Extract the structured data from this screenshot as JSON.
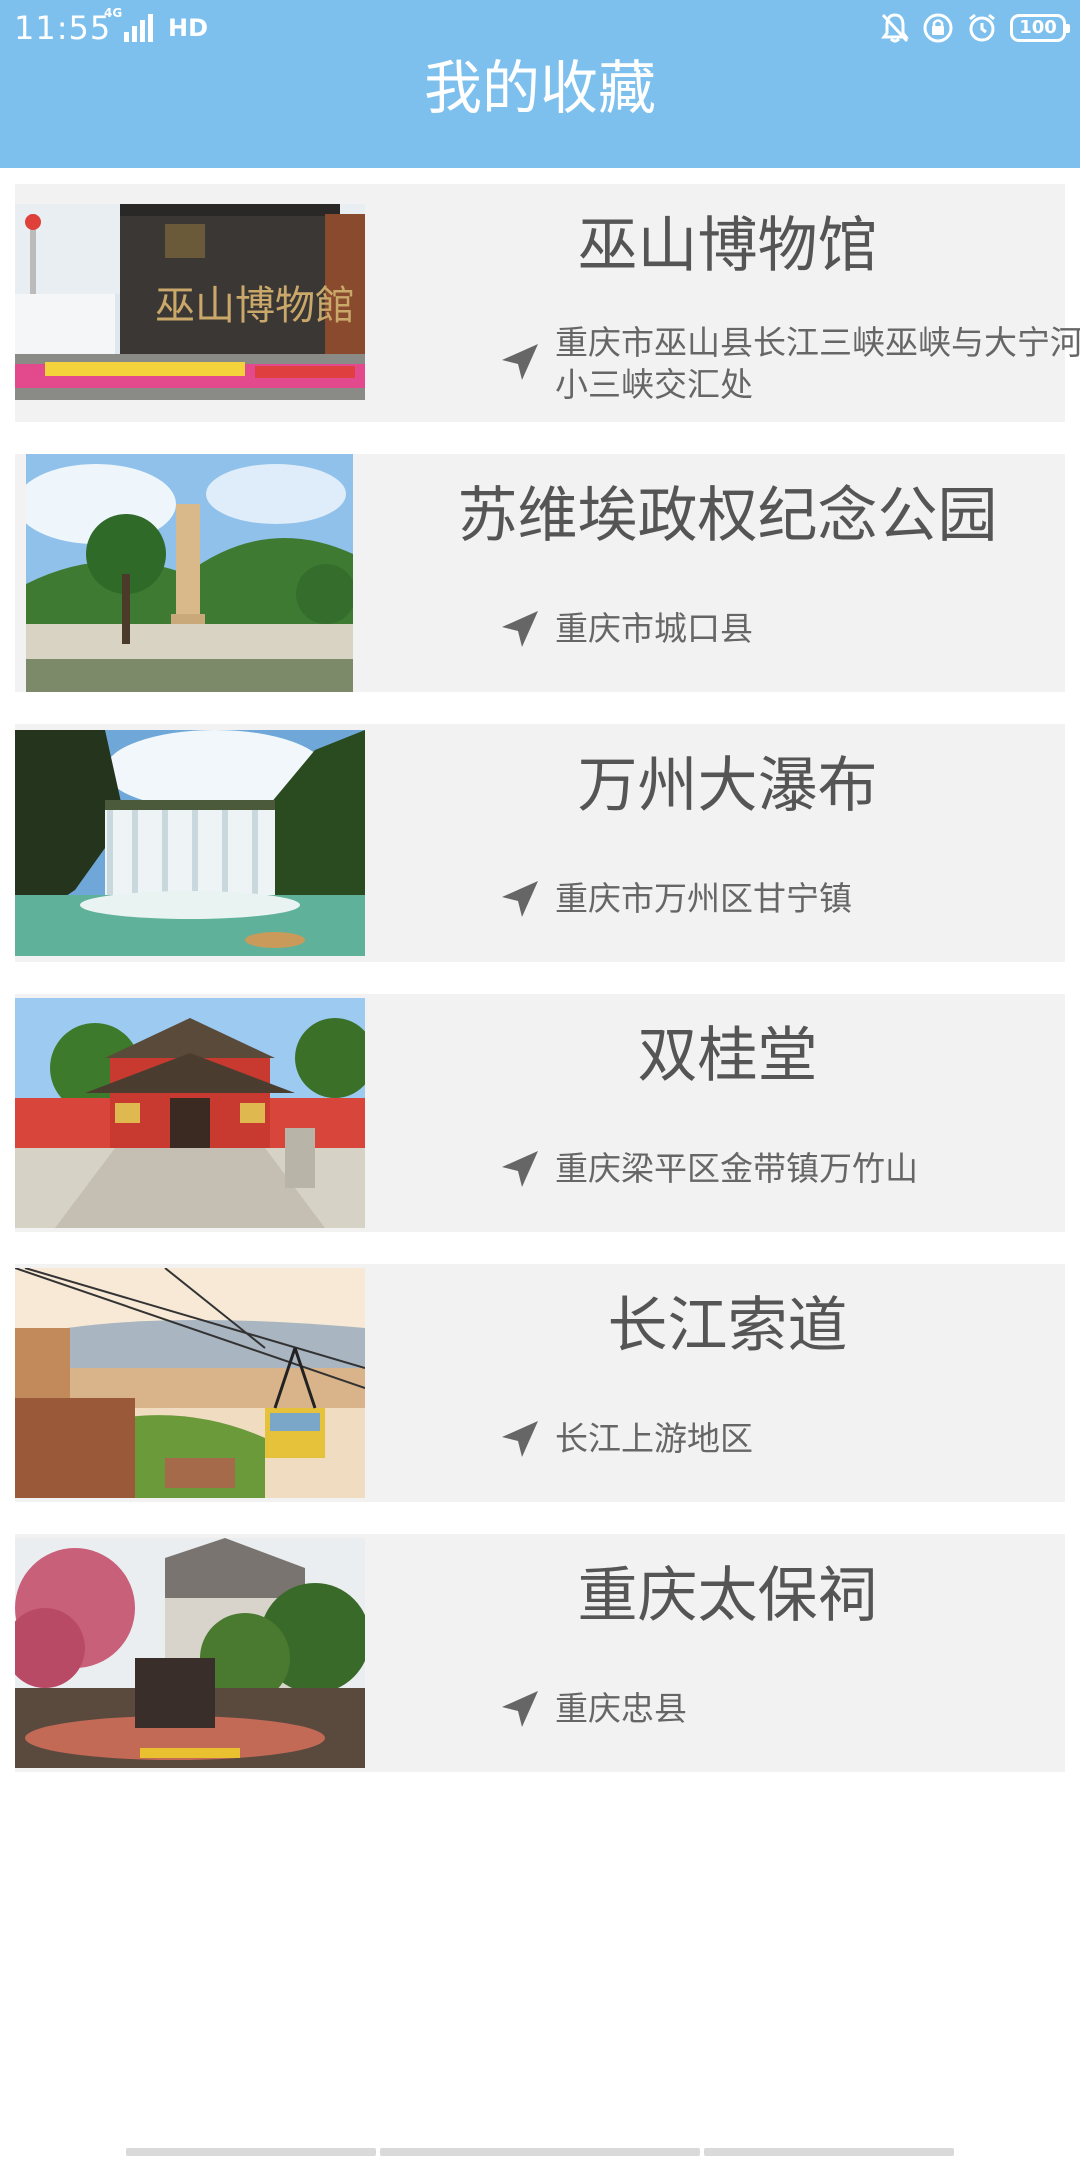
{
  "status_bar": {
    "time": "11:55",
    "network": "4G",
    "hd": "HD",
    "battery": "100"
  },
  "header": {
    "title": "我的收藏"
  },
  "favorites": [
    {
      "name": "巫山博物馆",
      "address": "重庆市巫山县长江三峡巫峡与大宁河小三峡交汇处",
      "image": "museum-photo"
    },
    {
      "name": "苏维埃政权纪念公园",
      "address": "重庆市城口县",
      "image": "memorial-park-photo"
    },
    {
      "name": "万州大瀑布",
      "address": "重庆市万州区甘宁镇",
      "image": "waterfall-photo"
    },
    {
      "name": "双桂堂",
      "address": "重庆梁平区金带镇万竹山",
      "image": "temple-photo"
    },
    {
      "name": "长江索道",
      "address": "长江上游地区",
      "image": "cable-car-photo"
    },
    {
      "name": "重庆太保祠",
      "address": "重庆忠县",
      "image": "ancestral-hall-photo"
    }
  ],
  "colors": {
    "header": "#7dc0ee",
    "card": "#f2f2f2",
    "title_text": "#555555",
    "address_text": "#666666"
  }
}
